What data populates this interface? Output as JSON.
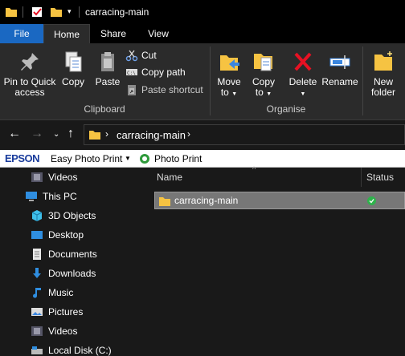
{
  "window": {
    "title": "carracing-main"
  },
  "ribbon_tabs": {
    "file": "File",
    "home": "Home",
    "share": "Share",
    "view": "View"
  },
  "clipboard": {
    "pin_line1": "Pin to Quick",
    "pin_line2": "access",
    "copy": "Copy",
    "paste": "Paste",
    "cut": "Cut",
    "copy_path": "Copy path",
    "paste_shortcut": "Paste shortcut",
    "group_label": "Clipboard"
  },
  "organise": {
    "move_line1": "Move",
    "move_line2": "to",
    "copy_line1": "Copy",
    "copy_line2": "to",
    "delete": "Delete",
    "rename": "Rename",
    "group_label": "Organise"
  },
  "new": {
    "line1": "New",
    "line2": "folder"
  },
  "address": {
    "path": "carracing-main"
  },
  "epson": {
    "logo": "EPSON",
    "easy_photo_print": "Easy Photo Print",
    "photo_print": "Photo Print"
  },
  "nav": {
    "videos_top": "Videos",
    "this_pc": "This PC",
    "objects3d": "3D Objects",
    "desktop": "Desktop",
    "documents": "Documents",
    "downloads": "Downloads",
    "music": "Music",
    "pictures": "Pictures",
    "videos": "Videos",
    "local_disk": "Local Disk (C:)"
  },
  "file_list": {
    "columns": {
      "name": "Name",
      "status": "Status"
    },
    "rows": [
      {
        "name": "carracing-main",
        "status_icon": "sync-ok-icon"
      }
    ]
  },
  "colors": {
    "file_tab": "#1a68c2",
    "folder": "#f6c342",
    "status_ok": "#2fb24c",
    "delete": "#e81123"
  }
}
